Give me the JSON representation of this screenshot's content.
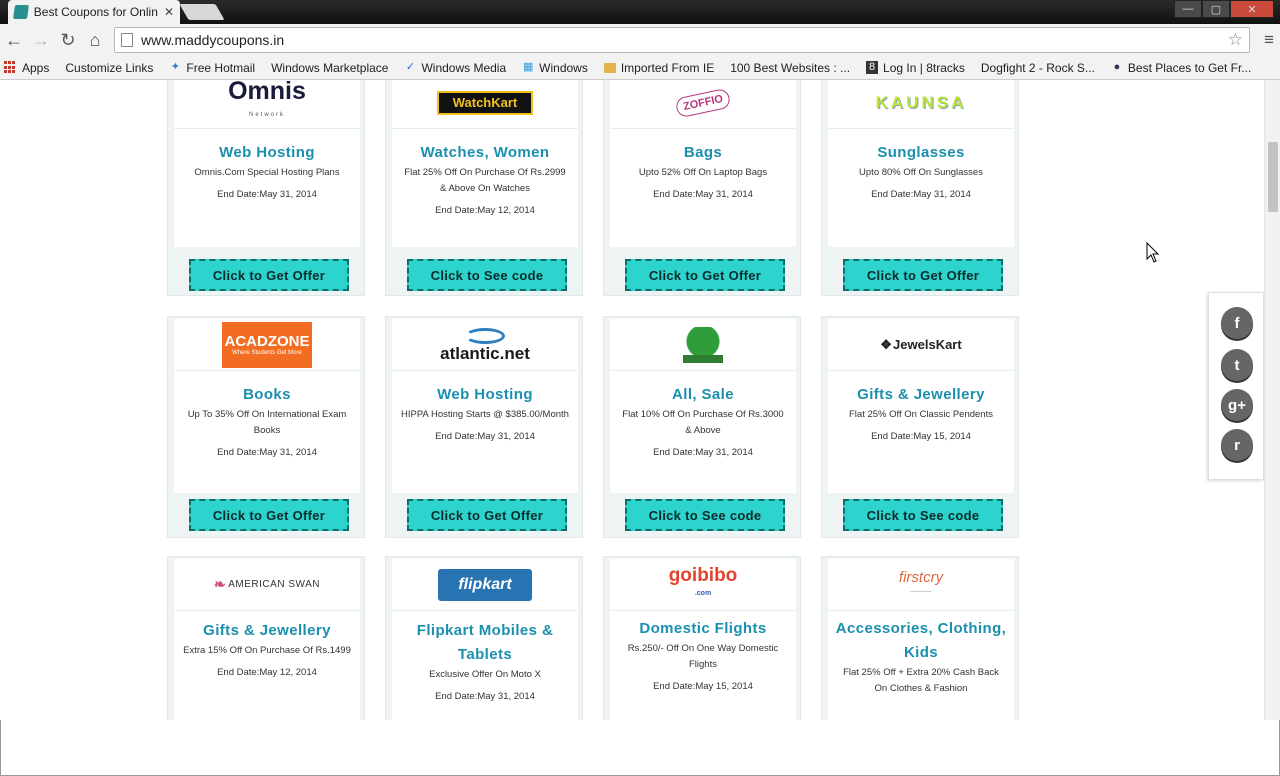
{
  "browser": {
    "tab_title": "Best Coupons for Online S",
    "tab_close": "✕",
    "url": "www.maddycoupons.in",
    "win_buttons": [
      "—",
      "▢",
      "✕"
    ],
    "bookmarks": [
      "Apps",
      "Customize Links",
      "Free Hotmail",
      "Windows Marketplace",
      "Windows Media",
      "Windows",
      "Imported From IE",
      "100 Best Websites : ...",
      "Log In | 8tracks",
      "Dogfight 2 - Rock S...",
      "Best Places to Get Fr..."
    ]
  },
  "cards": [
    {
      "logo": "Omnis",
      "logo_sub": "Network",
      "category": "Web Hosting",
      "desc": "Omnis.Com Special Hosting Plans",
      "end": "End Date:May 31, 2014",
      "button": "Click to Get Offer"
    },
    {
      "logo": "WatchKart",
      "category": "Watches, Women",
      "desc": "Flat 25% Off On Purchase Of Rs.2999 & Above On Watches",
      "end": "End Date:May 12, 2014",
      "button": "Click to See code"
    },
    {
      "logo": "ZOFFIO",
      "category": "Bags",
      "desc": "Upto 52% Off On Laptop Bags",
      "end": "End Date:May 31, 2014",
      "button": "Click to Get Offer"
    },
    {
      "logo": "KAUNSA",
      "category": "Sunglasses",
      "desc": "Upto 80% Off On Sunglasses",
      "end": "End Date:May 31, 2014",
      "button": "Click to Get Offer"
    },
    {
      "logo": "ACADZONE",
      "logo_sub": "Where Students Get More",
      "category": "Books",
      "desc": "Up To 35% Off On International Exam Books",
      "end": "End Date:May 31, 2014",
      "button": "Click to Get Offer"
    },
    {
      "logo": "atlantic.net",
      "category": "Web Hosting",
      "desc": "HIPPA Hosting Starts @ $385.00/Month",
      "end": "End Date:May 31, 2014",
      "button": "Click to Get Offer"
    },
    {
      "logo": "",
      "category": "All, Sale",
      "desc": "Flat 10% Off On Purchase Of Rs.3000 & Above",
      "end": "End Date:May 31, 2014",
      "button": "Click to See code"
    },
    {
      "logo": "JewelsKart",
      "category": "Gifts & Jewellery",
      "desc": "Flat 25% Off On Classic Pendents",
      "end": "End Date:May 15, 2014",
      "button": "Click to See code"
    },
    {
      "logo": "AMERICAN SWAN",
      "category": "Gifts & Jewellery",
      "desc": "Extra 15% Off On Purchase Of Rs.1499",
      "end": "End Date:May 12, 2014",
      "button": ""
    },
    {
      "logo": "flipkart",
      "category": "Flipkart Mobiles & Tablets",
      "desc": "Exclusive Offer On Moto X",
      "end": "End Date:May 31, 2014",
      "button": ""
    },
    {
      "logo": "goibibo",
      "logo_sub": ".com",
      "category": "Domestic Flights",
      "desc": "Rs.250/- Off On One Way Domestic Flights",
      "end": "End Date:May 15, 2014",
      "button": ""
    },
    {
      "logo": "firstcry",
      "category": "Accessories, Clothing, Kids",
      "desc": "Flat 25% Off + Extra 20% Cash Back On Clothes & Fashion",
      "end": "",
      "button": ""
    }
  ],
  "share": {
    "facebook": "f",
    "twitter": "t",
    "google": "g+",
    "reddit": "r"
  }
}
